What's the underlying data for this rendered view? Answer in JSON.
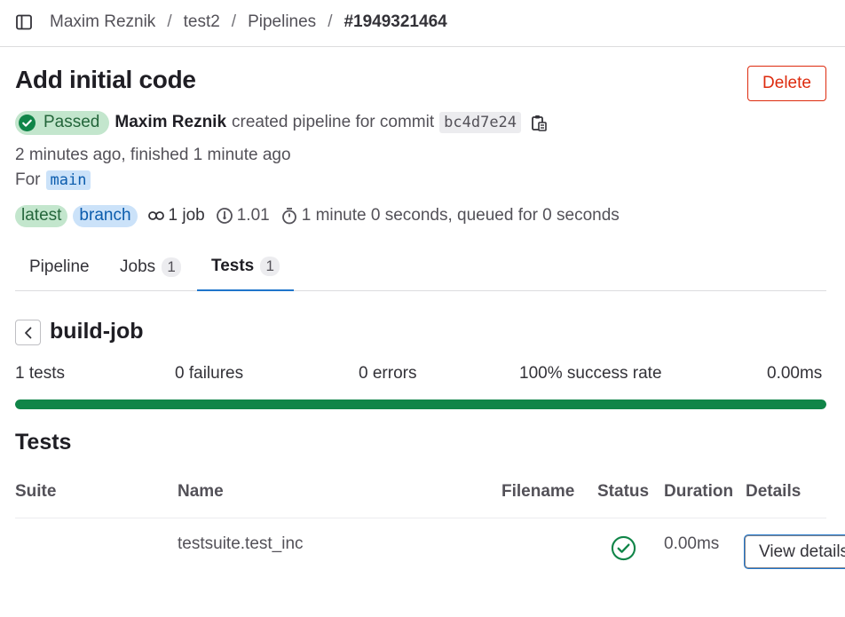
{
  "breadcrumb": [
    "Maxim Reznik",
    "test2",
    "Pipelines",
    "#1949321464"
  ],
  "header": {
    "title": "Add initial code",
    "delete_label": "Delete"
  },
  "pipeline": {
    "status": "Passed",
    "author": "Maxim Reznik",
    "action_text": "created pipeline for commit",
    "commit_sha": "bc4d7e24",
    "time_text": "2 minutes ago, finished 1 minute ago",
    "for_label": "For",
    "ref": "main",
    "badges": [
      "latest",
      "branch"
    ],
    "jobs_text": "1 job",
    "version_text": "1.01",
    "duration_text": "1 minute 0 seconds, queued for 0 seconds"
  },
  "tabs": [
    {
      "label": "Pipeline",
      "count": ""
    },
    {
      "label": "Jobs",
      "count": "1"
    },
    {
      "label": "Tests",
      "count": "1",
      "active": true
    }
  ],
  "job": {
    "name": "build-job"
  },
  "summary": {
    "tests": "1 tests",
    "failures": "0 failures",
    "errors": "0 errors",
    "success_rate": "100% success rate",
    "duration": "0.00ms",
    "success_fraction": 1.0
  },
  "tests_section": {
    "heading": "Tests",
    "columns": [
      "Suite",
      "Name",
      "Filename",
      "Status",
      "Duration",
      "Details"
    ],
    "rows": [
      {
        "suite": "",
        "name": "testsuite.test_inc",
        "filename": "",
        "status": "success",
        "duration": "0.00ms",
        "details_label": "View details"
      }
    ]
  },
  "colors": {
    "success": "#108548",
    "danger": "#dd2b0e",
    "link": "#1f75cb"
  }
}
